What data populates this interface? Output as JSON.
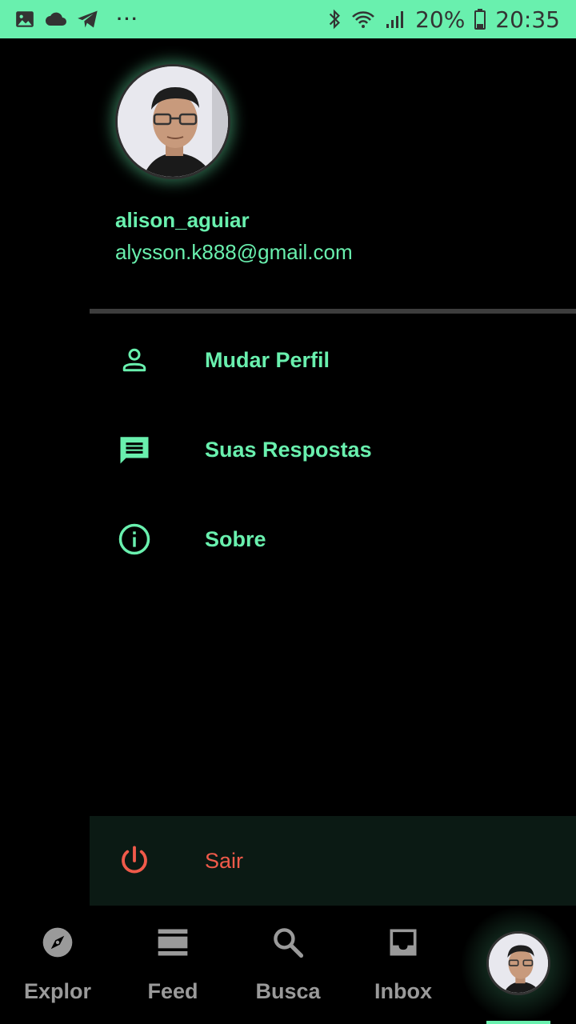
{
  "status_bar": {
    "battery": "20%",
    "time": "20:35",
    "icons": [
      "gallery-icon",
      "cloud-icon",
      "telegram-icon",
      "more-icon",
      "bluetooth-icon",
      "wifi-icon",
      "signal-icon",
      "battery-icon"
    ],
    "background": "#69f0ae"
  },
  "drawer": {
    "username": "alison_aguiar",
    "email": "alysson.k888@gmail.com",
    "menu": [
      {
        "label": "Mudar Perfil",
        "icon": "person-icon"
      },
      {
        "label": "Suas Respostas",
        "icon": "message-icon"
      },
      {
        "label": "Sobre",
        "icon": "info-icon"
      }
    ],
    "logout": {
      "label": "Sair",
      "icon": "power-icon"
    },
    "accent": "#69f0ae",
    "logout_color": "#f05a4a"
  },
  "bottom_nav": {
    "items": [
      {
        "label": "Explor",
        "icon": "compass-icon"
      },
      {
        "label": "Feed",
        "icon": "feed-icon"
      },
      {
        "label": "Busca",
        "icon": "search-icon"
      },
      {
        "label": "Inbox",
        "icon": "inbox-icon"
      }
    ],
    "profile": {
      "icon": "avatar"
    }
  }
}
